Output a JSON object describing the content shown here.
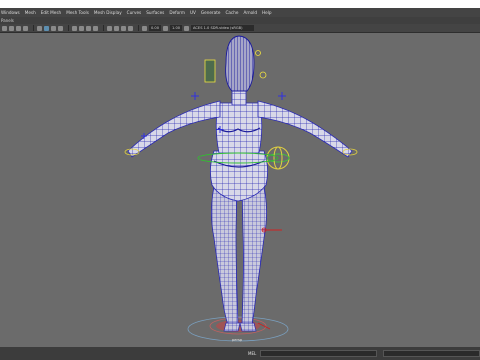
{
  "menubar": {
    "items": [
      "Windows",
      "Mesh",
      "Edit Mesh",
      "Mesh Tools",
      "Mesh Display",
      "Curves",
      "Surfaces",
      "Deform",
      "UV",
      "Generate",
      "Cache",
      "Arnold",
      "Help"
    ]
  },
  "panelbar": {
    "label": "Panels"
  },
  "toolbar": {
    "field_value_1": "0.00",
    "field_value_2": "1.00",
    "color_space": "ACES 1.0 SDR-video (sRGB)"
  },
  "viewport": {
    "camera_label": "persp",
    "background_color": "#6b6b6b",
    "wireframe_color": "#2a2ab4"
  },
  "commandline": {
    "tag": "MEL"
  }
}
